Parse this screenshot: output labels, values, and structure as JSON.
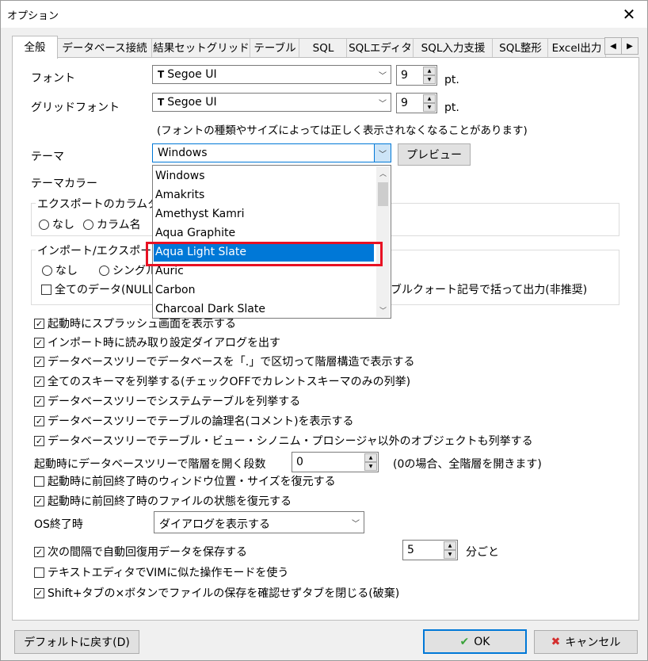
{
  "window": {
    "title": "オプション"
  },
  "tabs": [
    {
      "label": "全般"
    },
    {
      "label": "データベース接続"
    },
    {
      "label": "結果セットグリッド"
    },
    {
      "label": "テーブル"
    },
    {
      "label": "SQL"
    },
    {
      "label": "SQLエディタ"
    },
    {
      "label": "SQL入力支援"
    },
    {
      "label": "SQL整形"
    },
    {
      "label": "Excel出力"
    }
  ],
  "font": {
    "label": "フォント",
    "value": "Segoe UI",
    "size": "9",
    "unit": "pt."
  },
  "grid_font": {
    "label": "グリッドフォント",
    "value": "Segoe UI",
    "size": "9",
    "unit": "pt."
  },
  "font_note": "(フォントの種類やサイズによっては正しく表示されなくなることがあります)",
  "theme": {
    "label": "テーマ",
    "value": "Windows",
    "preview_label": "プレビュー"
  },
  "theme_color_label": "テーマカラー",
  "theme_options": [
    "Windows",
    "Amakrits",
    "Amethyst Kamri",
    "Aqua Graphite",
    "Aqua Light Slate",
    "Auric",
    "Carbon",
    "Charcoal Dark Slate"
  ],
  "theme_selected": "Aqua Light Slate",
  "export_group": {
    "title": "エクスポートのカラムタイ",
    "radio1": "なし",
    "radio2": "カラム名"
  },
  "import_group": {
    "title": "インポート/エクスポー",
    "radio1": "なし",
    "radio2": "シングル",
    "check_left": "全てのデータ(NULLI",
    "check_right": "ダブルクォート記号で括って出力(非推奨)"
  },
  "checkboxes": [
    {
      "label": "起動時にスプラッシュ画面を表示する",
      "checked": true
    },
    {
      "label": "インポート時に読み取り設定ダイアログを出す",
      "checked": true
    },
    {
      "label": "データベースツリーでデータベースを「.」で区切って階層構造で表示する",
      "checked": true
    },
    {
      "label": "全てのスキーマを列挙する(チェックOFFでカレントスキーマのみの列挙)",
      "checked": true
    },
    {
      "label": "データベースツリーでシステムテーブルを列挙する",
      "checked": true
    },
    {
      "label": "データベースツリーでテーブルの論理名(コメント)を表示する",
      "checked": true
    },
    {
      "label": "データベースツリーでテーブル・ビュー・シノニム・プロシージャ以外のオブジェクトも列挙する",
      "checked": true
    }
  ],
  "tree_depth": {
    "label": "起動時にデータベースツリーで階層を開く段数",
    "value": "0",
    "note": "(0の場合、全階層を開きます)"
  },
  "restore_window": {
    "label": "起動時に前回終了時のウィンドウ位置・サイズを復元する",
    "checked": false
  },
  "restore_files": {
    "label": "起動時に前回終了時のファイルの状態を復元する",
    "checked": true
  },
  "os_exit": {
    "label": "OS終了時",
    "value": "ダイアログを表示する"
  },
  "autosave": {
    "label": "次の間隔で自動回復用データを保存する",
    "checked": true,
    "value": "5",
    "unit": "分ごと"
  },
  "vim_mode": {
    "label": "テキストエディタでVIMに似た操作モードを使う",
    "checked": false
  },
  "close_tab": {
    "label": "Shift+タブの×ボタンでファイルの保存を確認せずタブを閉じる(破棄)",
    "checked": true
  },
  "buttons": {
    "default": "デフォルトに戻す(D)",
    "ok": "OK",
    "cancel": "キャンセル"
  },
  "colors": {
    "accent": "#0078d7",
    "highlight_border": "#e81123"
  }
}
